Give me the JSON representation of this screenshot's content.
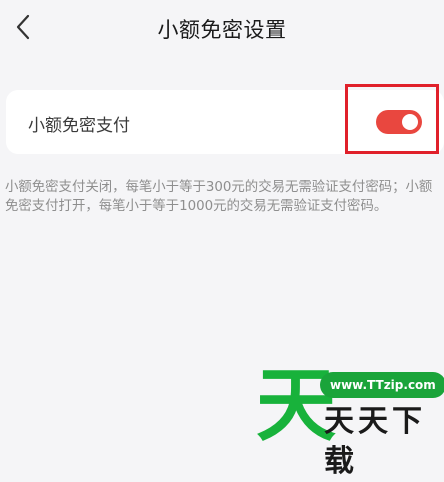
{
  "header": {
    "title": "小额免密设置",
    "back_icon": "chevron-left-icon"
  },
  "setting": {
    "label": "小额免密支付",
    "enabled": true,
    "toggle_color": "#e9473f"
  },
  "description": "小额免密支付关闭，每笔小于等于300元的交易无需验证支付密码；小额免密支付打开，每笔小于等于1000元的交易无需验证支付密码。",
  "watermark": {
    "logo_char": "天",
    "url": "www.TTzip.com",
    "text": "天天下载"
  },
  "colors": {
    "background": "#f5f5f7",
    "highlight": "#e0202a",
    "watermark_green": "#18b23b"
  }
}
